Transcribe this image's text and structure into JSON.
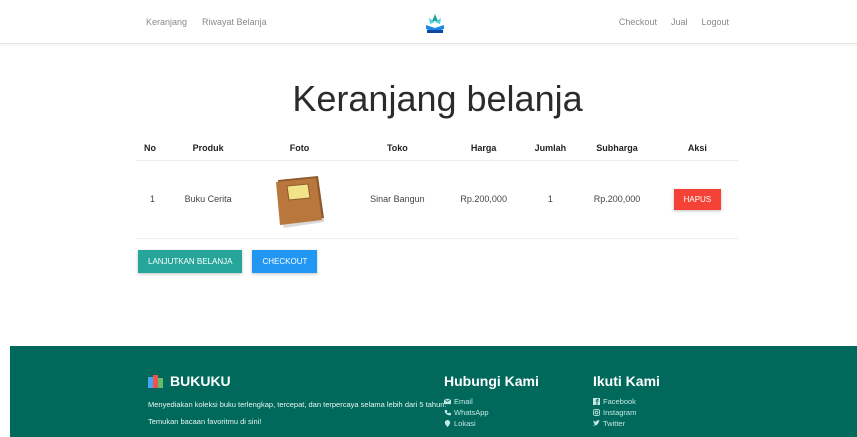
{
  "nav": {
    "left": [
      "Keranjang",
      "Riwayat Belanja"
    ],
    "right": [
      "Checkout",
      "Jual",
      "Logout"
    ]
  },
  "page": {
    "title": "Keranjang belanja"
  },
  "cart": {
    "headers": [
      "No",
      "Produk",
      "Foto",
      "Toko",
      "Harga",
      "Jumlah",
      "Subharga",
      "Aksi"
    ],
    "rows": [
      {
        "no": "1",
        "produk": "Buku Cerita",
        "toko": "Sinar Bangun",
        "harga": "Rp.200,000",
        "jumlah": "1",
        "subharga": "Rp.200,000",
        "aksi": "HAPUS"
      }
    ]
  },
  "actions": {
    "continue": "LANJUTKAN BELANJA",
    "checkout": "CHECKOUT"
  },
  "footer": {
    "brand": "BUKUKU",
    "description": "Menyediakan koleksi buku terlengkap, tercepat, dan terpercaya selama lebih dari 5 tahun. Temukan bacaan favoritmu di sini!",
    "contact_title": "Hubungi Kami",
    "contact_items": [
      "Email",
      "WhatsApp",
      "Lokasi"
    ],
    "follow_title": "Ikuti Kami",
    "follow_items": [
      "Facebook",
      "Instagram",
      "Twitter"
    ]
  },
  "colors": {
    "footer": "#00695c",
    "teal_button": "#26a69a",
    "blue_button": "#2196f3",
    "delete_button": "#f44336"
  }
}
